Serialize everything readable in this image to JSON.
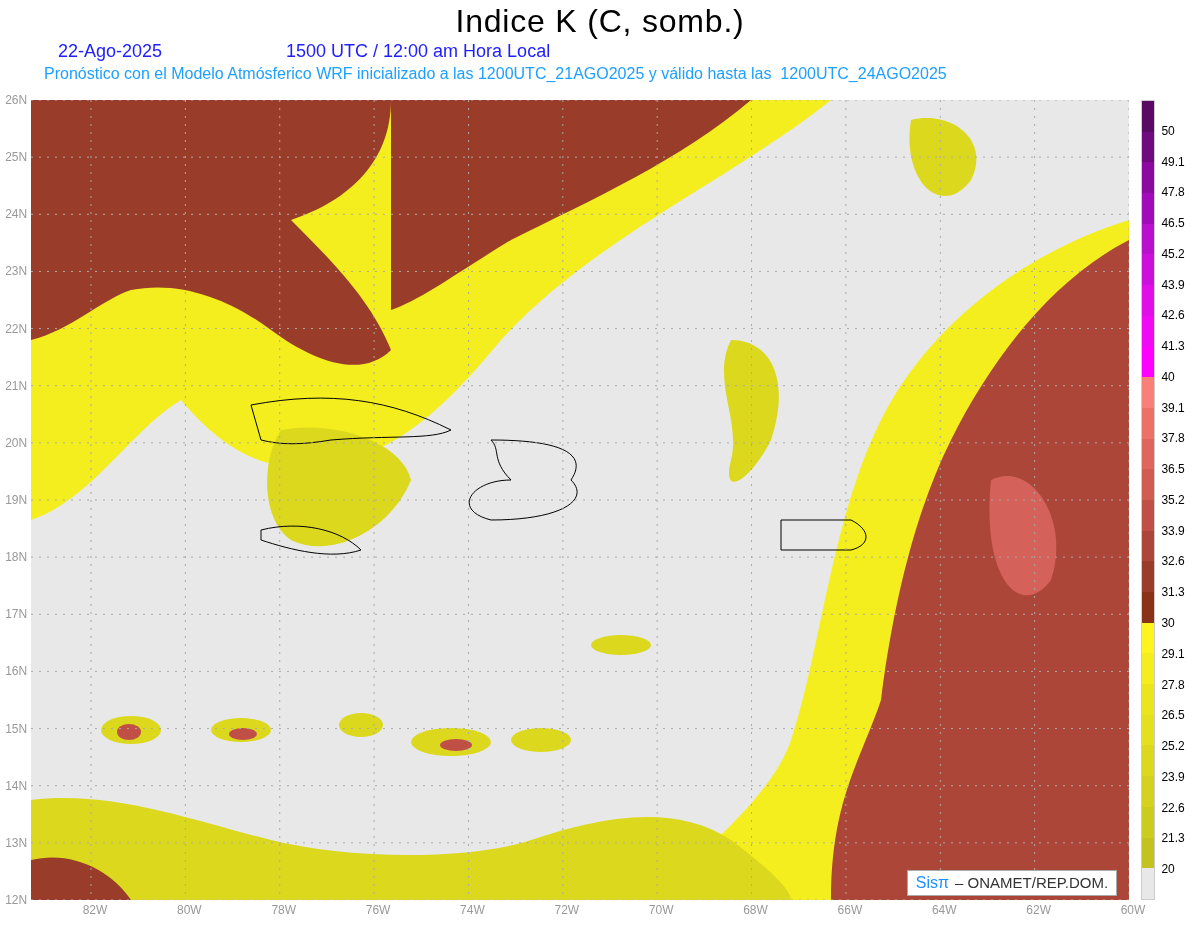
{
  "title": "Indice K (C, somb.)",
  "date": "22-Ago-2025",
  "time": "1500 UTC / 12:00 am Hora Local",
  "subtitle": "Pronóstico con el Modelo Atmósferico WRF inicializado a las 1200UTC_21AGO2025 y válido hasta las  1200UTC_24AGO2025",
  "lat_labels": [
    "26N",
    "25N",
    "24N",
    "23N",
    "22N",
    "21N",
    "20N",
    "19N",
    "18N",
    "17N",
    "16N",
    "15N",
    "14N",
    "13N",
    "12N"
  ],
  "lon_labels": [
    "82W",
    "80W",
    "78W",
    "76W",
    "74W",
    "72W",
    "70W",
    "68W",
    "66W",
    "64W",
    "62W",
    "60W"
  ],
  "credit": {
    "logo": "Sisπ",
    "text": "– ONAMET/REP.DOM."
  },
  "colorbar": {
    "segments": [
      {
        "color": "#5a0a64"
      },
      {
        "color": "#700a80"
      },
      {
        "color": "#8a0aa0"
      },
      {
        "color": "#a00ab8"
      },
      {
        "color": "#b810cc"
      },
      {
        "color": "#cc10dc"
      },
      {
        "color": "#e00ee8"
      },
      {
        "color": "#f00af4"
      },
      {
        "color": "#ff00ff"
      },
      {
        "color": "#f88078"
      },
      {
        "color": "#ec7268"
      },
      {
        "color": "#de665c"
      },
      {
        "color": "#d05c52"
      },
      {
        "color": "#c05046"
      },
      {
        "color": "#ac4638"
      },
      {
        "color": "#9a3c2a"
      },
      {
        "color": "#8a3218"
      },
      {
        "color": "#fff41e"
      },
      {
        "color": "#f4ee1e"
      },
      {
        "color": "#ebe51e"
      },
      {
        "color": "#e4e01e"
      },
      {
        "color": "#dcd81e"
      },
      {
        "color": "#d4d21e"
      },
      {
        "color": "#cccc1e"
      },
      {
        "color": "#c4c21e"
      },
      {
        "color": "#e8e8e8"
      }
    ],
    "labels": [
      "50",
      "49.1",
      "47.8",
      "46.5",
      "45.2",
      "43.9",
      "42.6",
      "41.3",
      "40",
      "39.1",
      "37.8",
      "36.5",
      "35.2",
      "33.9",
      "32.6",
      "31.3",
      "30",
      "29.1",
      "27.8",
      "26.5",
      "25.2",
      "23.9",
      "22.6",
      "21.3",
      "20"
    ]
  }
}
